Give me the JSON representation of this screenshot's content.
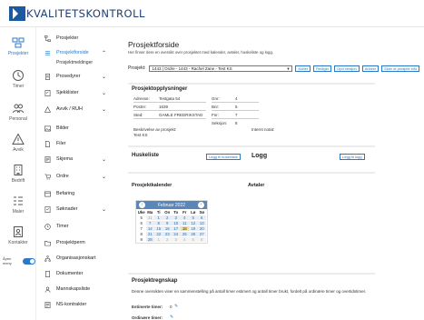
{
  "brand": {
    "logo_text": "KVALITETSKONTROLL",
    "accent": "#2a78c8"
  },
  "rail": [
    {
      "label": "Prosjekter",
      "icon": "projects-icon",
      "active": true
    },
    {
      "label": "Timer",
      "icon": "clock-icon"
    },
    {
      "label": "Personal",
      "icon": "people-icon"
    },
    {
      "label": "Avvik",
      "icon": "warning-icon"
    },
    {
      "label": "Bedrift",
      "icon": "building-icon"
    },
    {
      "label": "Maler",
      "icon": "templates-icon"
    },
    {
      "label": "Kontakter",
      "icon": "contacts-icon"
    }
  ],
  "rail_toggle_label": "Åpen meny",
  "menu": [
    {
      "label": "Prosjekter",
      "icon": "sitemap-icon",
      "chev": ""
    },
    {
      "label": "Prosjektforside",
      "icon": "list-icon",
      "chev": "⌃",
      "active": true
    },
    {
      "label": "Prosedyrer",
      "icon": "doc-icon",
      "chev": "⌄"
    },
    {
      "label": "Sjekklister",
      "icon": "checklist-icon",
      "chev": "⌄"
    },
    {
      "label": "Avvik / RUH",
      "icon": "warning-icon",
      "chev": "⌄"
    },
    {
      "label": "Bilder",
      "icon": "image-icon",
      "chev": ""
    },
    {
      "label": "Filer",
      "icon": "file-icon",
      "chev": ""
    },
    {
      "label": "Skjema",
      "icon": "form-icon",
      "chev": "⌄"
    },
    {
      "label": "Ordre",
      "icon": "order-icon",
      "chev": "⌄"
    },
    {
      "label": "Befaring",
      "icon": "inspection-icon",
      "chev": ""
    },
    {
      "label": "Søknader",
      "icon": "application-icon",
      "chev": "⌄"
    },
    {
      "label": "Timer",
      "icon": "clock-icon",
      "chev": ""
    },
    {
      "label": "Prosjektperm",
      "icon": "folder-icon",
      "chev": ""
    },
    {
      "label": "Organisasjonskart",
      "icon": "org-icon",
      "chev": ""
    },
    {
      "label": "Dokumenter",
      "icon": "documents-icon",
      "chev": ""
    },
    {
      "label": "Mannskapsliste",
      "icon": "crew-icon",
      "chev": ""
    },
    {
      "label": "NS-kontrakter",
      "icon": "contract-icon",
      "chev": ""
    }
  ],
  "menu_sub_label": "Prosjektmeldinger",
  "main": {
    "title": "Prosjektforside",
    "subtitle": "Her finner dere en oversikt over prosjektet med kalender, avtaler, huskeliste og logg.",
    "project_label": "Prosjekt:",
    "project_value": "1443 | Ordre - 1443 - Rachel Zane - Test KS",
    "buttons": [
      "Kutter",
      "Rediger",
      "Opd versjon",
      "Arkiver",
      "Skriv ut prosjekt info"
    ]
  },
  "info": {
    "title": "Prosjektopplysninger",
    "left": [
      {
        "k": "Adresse:",
        "v": "Testgata 54"
      },
      {
        "k": "Postnr:",
        "v": "1639"
      },
      {
        "k": "Sted:",
        "v": "GAMLE FREDRIKSTAD"
      }
    ],
    "right": [
      {
        "k": "Gnr:",
        "v": "4"
      },
      {
        "k": "Bnr:",
        "v": "5"
      },
      {
        "k": "Fnr:",
        "v": "7"
      },
      {
        "k": "Seksjon:",
        "v": "8"
      }
    ],
    "desc_label": "Beskrivelse av prosjekt:",
    "desc_value": "Test KS",
    "internal_label": "Internt notat:"
  },
  "huskeliste": {
    "title": "Huskeliste",
    "button": "Legg til huskeliste"
  },
  "logg": {
    "title": "Logg",
    "button": "Legg til logg"
  },
  "kalender": {
    "title": "Prosjektkalender",
    "month": "Februar",
    "year": "2022",
    "headers": [
      "Uke",
      "Ma",
      "Ti",
      "On",
      "To",
      "Fr",
      "Lø",
      "Sø"
    ],
    "weeks": [
      {
        "wk": "5",
        "days": [
          "31",
          "1",
          "2",
          "3",
          "4",
          "5",
          "6"
        ]
      },
      {
        "wk": "6",
        "days": [
          "7",
          "8",
          "9",
          "10",
          "11",
          "12",
          "13"
        ]
      },
      {
        "wk": "7",
        "days": [
          "14",
          "15",
          "16",
          "17",
          "18",
          "19",
          "20"
        ]
      },
      {
        "wk": "8",
        "days": [
          "21",
          "22",
          "23",
          "24",
          "25",
          "26",
          "27"
        ]
      },
      {
        "wk": "9",
        "days": [
          "28",
          "1",
          "2",
          "3",
          "4",
          "5",
          "6"
        ]
      }
    ],
    "today": "18"
  },
  "avtaler": {
    "title": "Avtaler"
  },
  "regnskap": {
    "title": "Prosjektregnskap",
    "desc": "Denne oversikten viser en sammenstelling på antall timer estimert og antall timer brukt, fordelt på ordinære timer og overtidstimer.",
    "est_label": "Estimerte timer:",
    "est_value": "0",
    "ord_label": "Ordinære timer:"
  }
}
